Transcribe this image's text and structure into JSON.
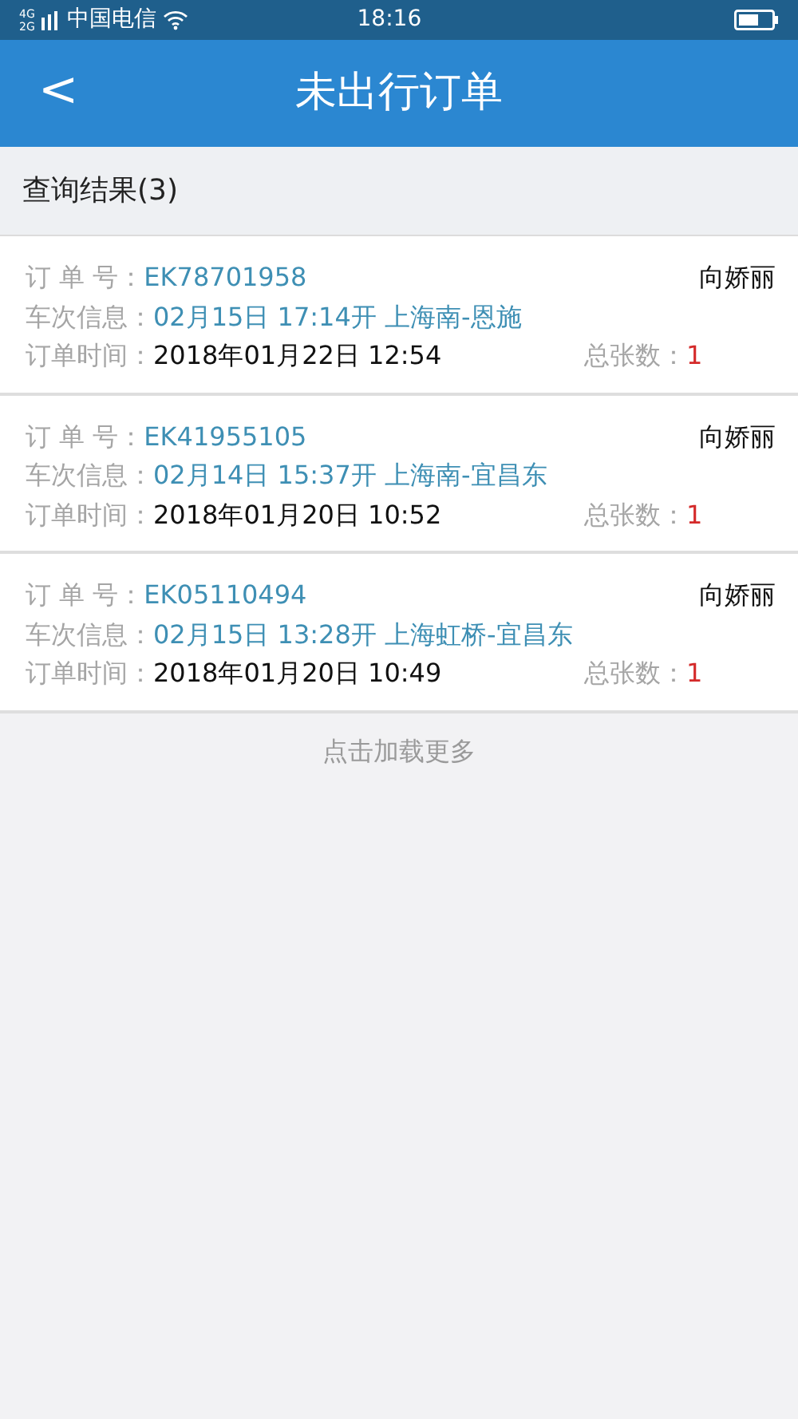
{
  "status_bar": {
    "network_top": "4G",
    "network_bottom": "2G",
    "carrier": "中国电信",
    "time": "18:16"
  },
  "header": {
    "back": "<",
    "title": "未出行订单"
  },
  "result_heading": "查询结果(3)",
  "orders": [
    {
      "order_no_label": "订 单 号：",
      "order_no": "EK78701958",
      "passenger": "向娇丽",
      "train_label": "车次信息：",
      "train": "02月15日 17:14开 上海南-恩施",
      "time_label": "订单时间：",
      "time": "2018年01月22日 12:54",
      "count_label": "总张数：",
      "count": "1"
    },
    {
      "order_no_label": "订 单 号：",
      "order_no": "EK41955105",
      "passenger": "向娇丽",
      "train_label": "车次信息：",
      "train": "02月14日 15:37开 上海南-宜昌东",
      "time_label": "订单时间：",
      "time": "2018年01月20日 10:52",
      "count_label": "总张数：",
      "count": "1"
    },
    {
      "order_no_label": "订 单 号：",
      "order_no": "EK05110494",
      "passenger": "向娇丽",
      "train_label": "车次信息：",
      "train": "02月15日 13:28开 上海虹桥-宜昌东",
      "time_label": "订单时间：",
      "time": "2018年01月20日 10:49",
      "count_label": "总张数：",
      "count": "1"
    }
  ],
  "load_more": "点击加载更多"
}
